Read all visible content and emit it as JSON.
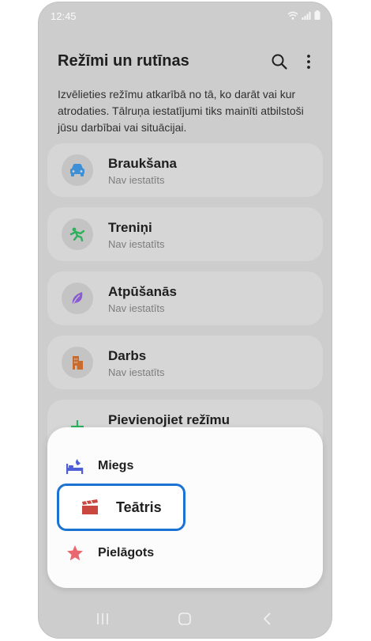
{
  "status_bar": {
    "time": "12:45"
  },
  "header": {
    "title": "Režīmi un rutīnas"
  },
  "description": "Izvēlieties režīmu atkarībā no tā, ko darāt vai kur atrodaties. Tālruņa iestatījumi tiks mainīti atbilstoši jūsu darbībai vai situācijai.",
  "modes": [
    {
      "name": "Braukšana",
      "status": "Nav iestatīts",
      "icon": "car-icon",
      "color": "#3d8fd6"
    },
    {
      "name": "Treniņi",
      "status": "Nav iestatīts",
      "icon": "running-person-icon",
      "color": "#2fb05d"
    },
    {
      "name": "Atpūšanās",
      "status": "Nav iestatīts",
      "icon": "leaf-icon",
      "color": "#8a5cd1"
    },
    {
      "name": "Darbs",
      "status": "Nav iestatīts",
      "icon": "building-icon",
      "color": "#c96a2e"
    }
  ],
  "add_mode": {
    "label": "Pievienojiet režīmu",
    "icon": "plus-icon",
    "color": "#2fb05d"
  },
  "sheet": {
    "items": [
      {
        "label": "Miegs",
        "icon": "bed-moon-icon",
        "color": "#4f5fd6"
      },
      {
        "label": "Teātris",
        "icon": "clapperboard-icon",
        "color": "#c9473f",
        "highlighted": true
      },
      {
        "label": "Pielāgots",
        "icon": "star-icon",
        "color": "#e8686d"
      }
    ]
  },
  "colors": {
    "highlight_border": "#1a73d4",
    "background_overlay": "#cdcdcd"
  }
}
